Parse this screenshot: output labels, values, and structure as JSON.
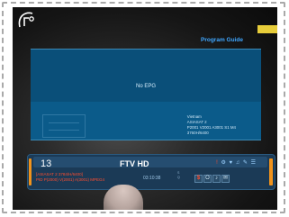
{
  "program_guide": {
    "title": "Program Guide",
    "no_epg": "No EPG",
    "satellite_name": "Vietnam",
    "satellite": "ASIASAT 2",
    "pid_short": "P2001 V2001 A3001 S1 M4",
    "freq_short": "3760H/6400"
  },
  "infobar": {
    "channel_number": "13",
    "channel_name": "FTV HD",
    "sat_line": "[ASIASAT 2 3784/H/6400]",
    "pid_line": "PID P(2000) V(2001) A(3001) MPEG4",
    "time": "03:10:38",
    "meter_top": "S",
    "meter_bottom": "Q",
    "flags": [
      "$",
      "O",
      "♪",
      "✉"
    ],
    "icons": [
      "!",
      "⚙",
      "♥",
      "♫",
      "✎",
      "☰"
    ]
  },
  "colors": {
    "panel_blue": "#0b5b8a",
    "accent_orange": "#f1931c",
    "title_blue": "#3fa7ff",
    "info_red": "#ff4d2e",
    "accent_yellow": "#e7cd3a"
  },
  "icon_names": [
    "receiver-logo-icon",
    "settings-icon",
    "favorite-icon",
    "music-icon",
    "edit-icon",
    "list-icon"
  ]
}
